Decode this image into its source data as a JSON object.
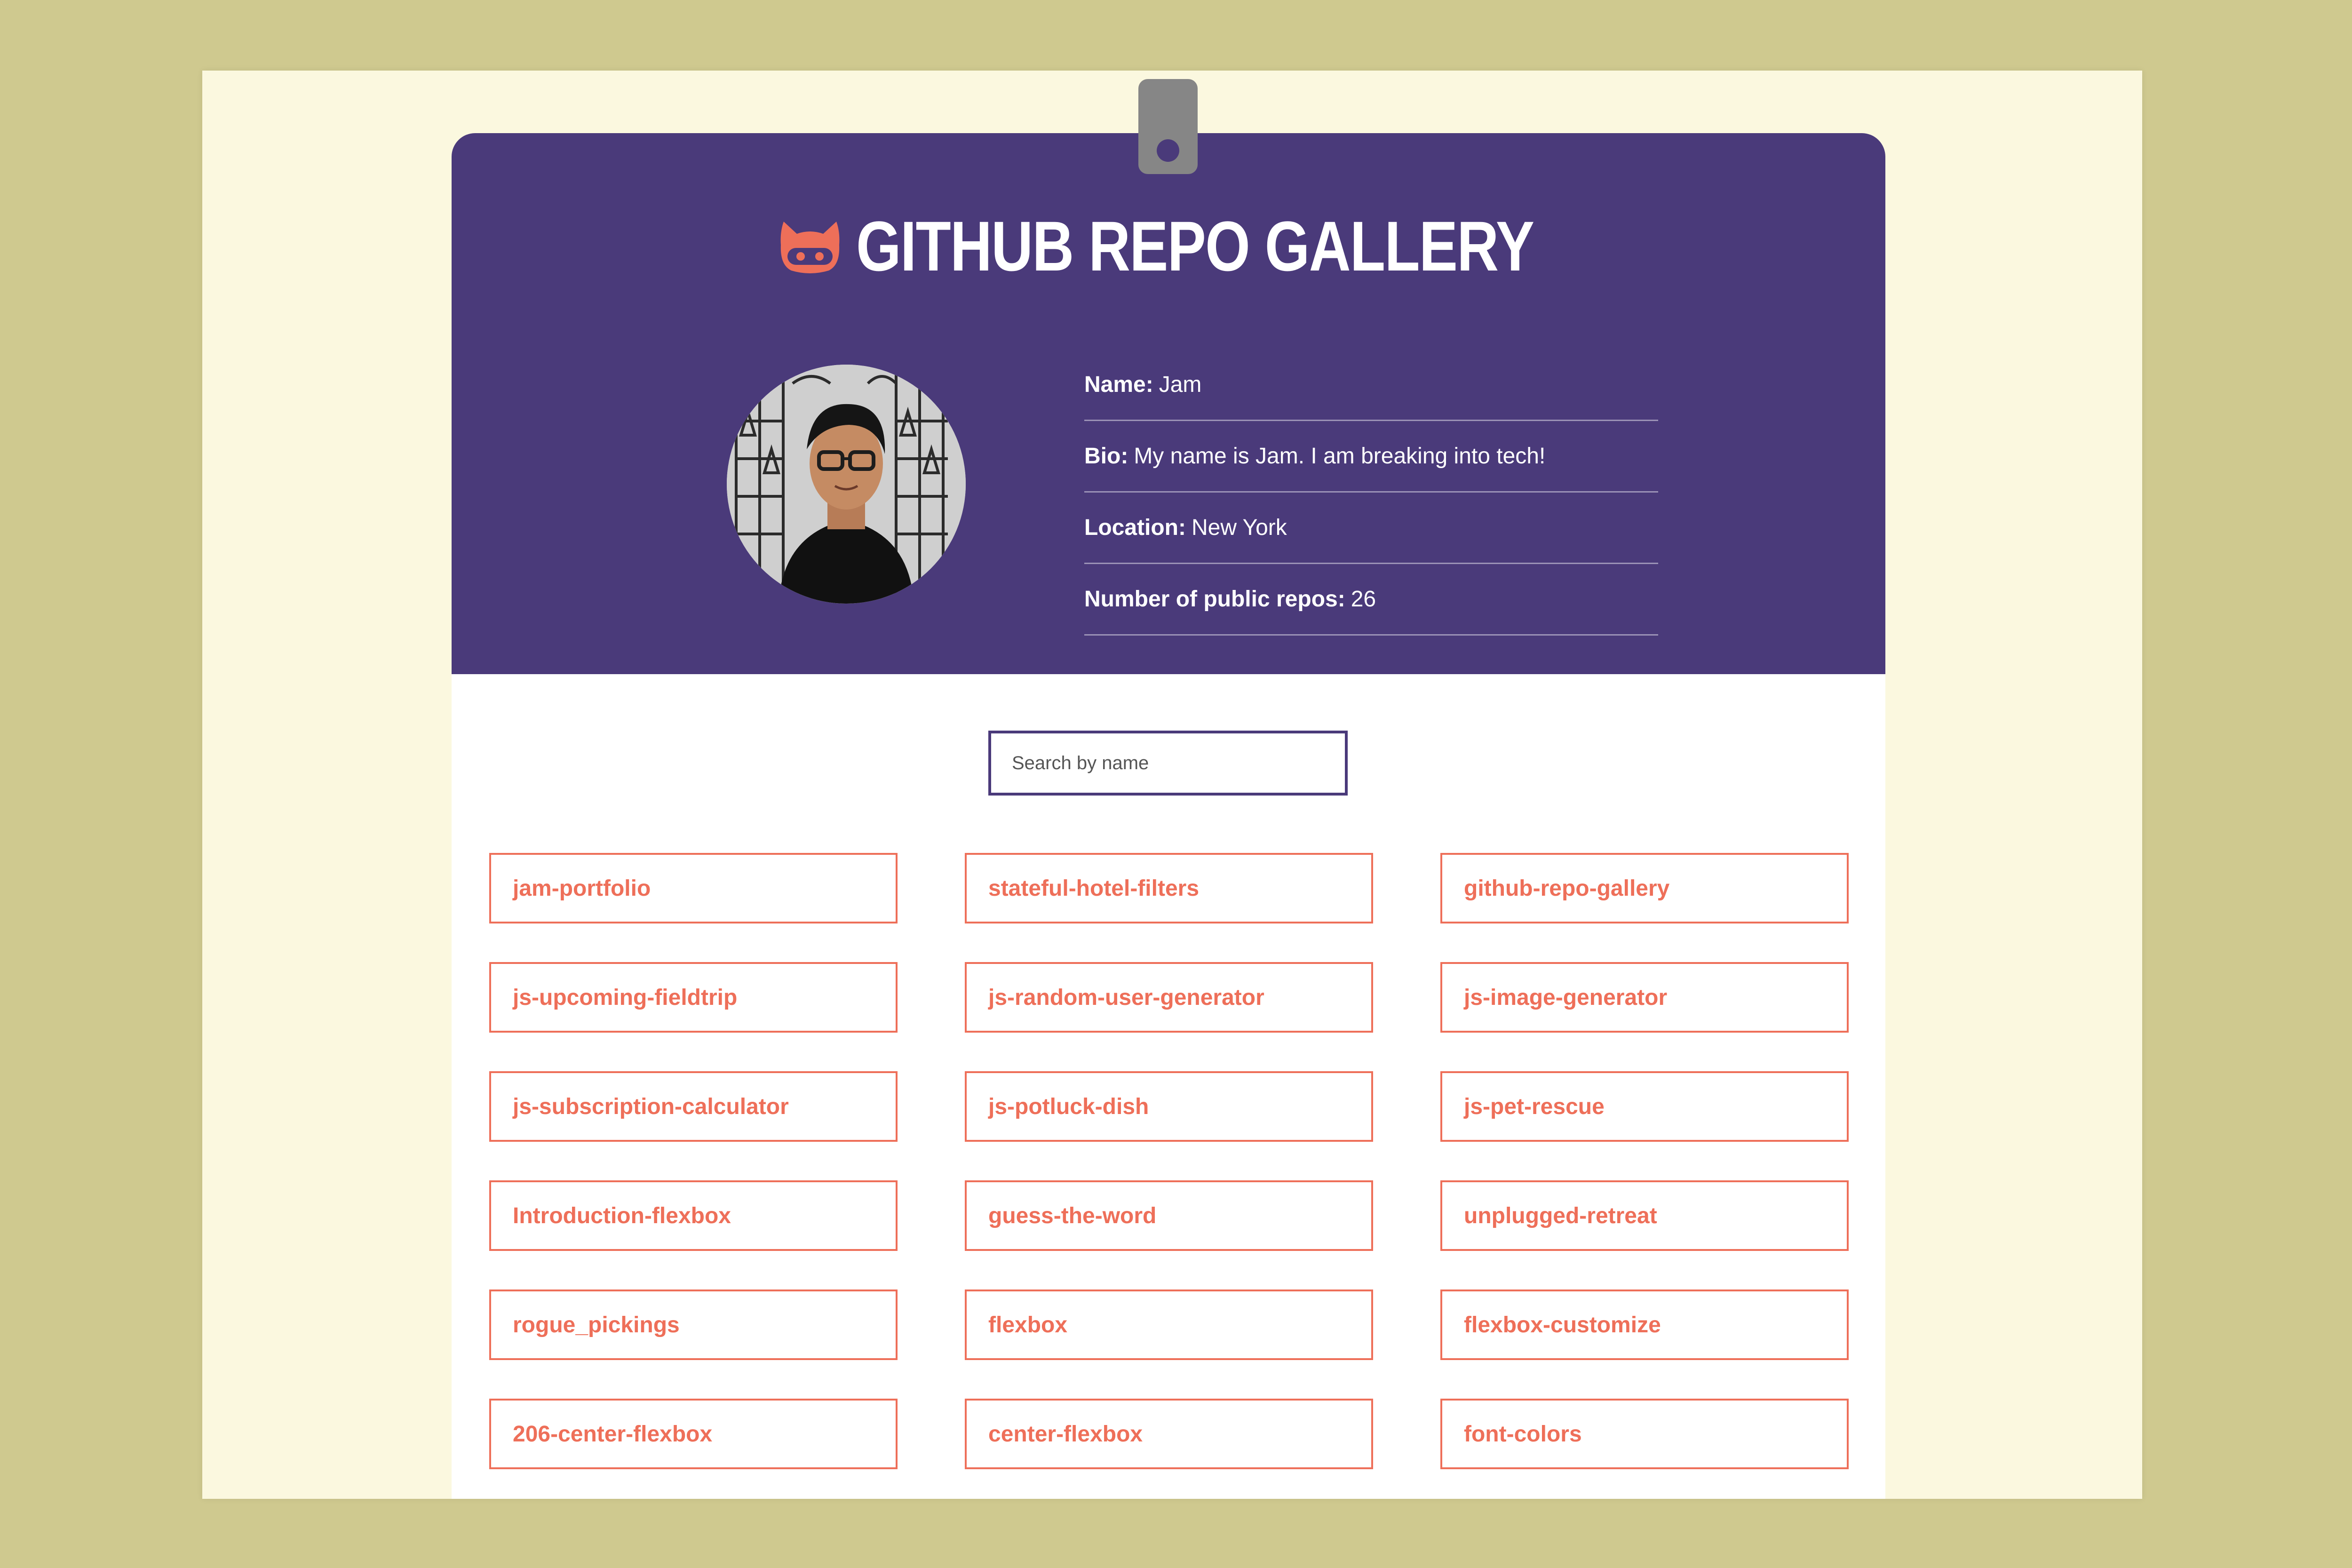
{
  "header": {
    "title": "GITHUB REPO GALLERY",
    "icon": "github-octocat-icon"
  },
  "profile": {
    "name_label": "Name:",
    "name": "Jam",
    "bio_label": "Bio:",
    "bio": "My name is Jam. I am breaking into tech!",
    "location_label": "Location:",
    "location": "New York",
    "repos_label": "Number of public repos:",
    "repos_count": "26"
  },
  "search": {
    "placeholder": "Search by name"
  },
  "repos": [
    {
      "name": "jam-portfolio"
    },
    {
      "name": "stateful-hotel-filters"
    },
    {
      "name": "github-repo-gallery"
    },
    {
      "name": "js-upcoming-fieldtrip"
    },
    {
      "name": "js-random-user-generator"
    },
    {
      "name": "js-image-generator"
    },
    {
      "name": "js-subscription-calculator"
    },
    {
      "name": "js-potluck-dish"
    },
    {
      "name": "js-pet-rescue"
    },
    {
      "name": "Introduction-flexbox"
    },
    {
      "name": "guess-the-word"
    },
    {
      "name": "unplugged-retreat"
    },
    {
      "name": "rogue_pickings"
    },
    {
      "name": "flexbox"
    },
    {
      "name": "flexbox-customize"
    },
    {
      "name": "206-center-flexbox"
    },
    {
      "name": "center-flexbox"
    },
    {
      "name": "font-colors"
    }
  ],
  "colors": {
    "background": "#cfc98f",
    "paper": "#fbf8df",
    "header": "#4a3a7a",
    "accent": "#ee6f59",
    "clip": "#868686"
  }
}
